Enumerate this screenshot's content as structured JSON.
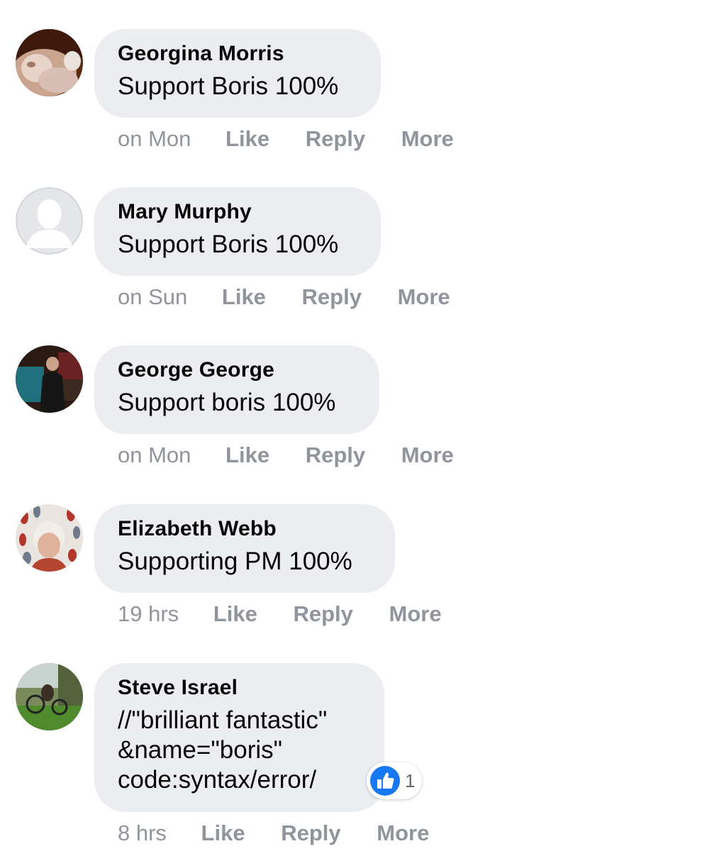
{
  "comments": [
    {
      "author": "Georgina Morris",
      "text": "Support Boris 100%",
      "time": "on Mon",
      "like": "Like",
      "reply": "Reply",
      "more": "More"
    },
    {
      "author": "Mary Murphy",
      "text": "Support Boris 100%",
      "time": "on Sun",
      "like": "Like",
      "reply": "Reply",
      "more": "More"
    },
    {
      "author": "George George",
      "text": "Support boris 100%",
      "time": "on Mon",
      "like": "Like",
      "reply": "Reply",
      "more": "More"
    },
    {
      "author": "Elizabeth Webb",
      "text": "Supporting PM 100%",
      "time": "19 hrs",
      "like": "Like",
      "reply": "Reply",
      "more": "More"
    },
    {
      "author": "Steve Israel",
      "text": "//\"brilliant fantastic\"\n&name=\"boris\"\ncode:syntax/error/",
      "time": "8 hrs",
      "like": "Like",
      "reply": "Reply",
      "more": "More",
      "reaction": {
        "icon": "thumbs-up-icon",
        "count": "1"
      }
    }
  ],
  "colors": {
    "bubble": "#ebedf0",
    "meta": "#90949c",
    "like_blue": "#1877f2"
  }
}
